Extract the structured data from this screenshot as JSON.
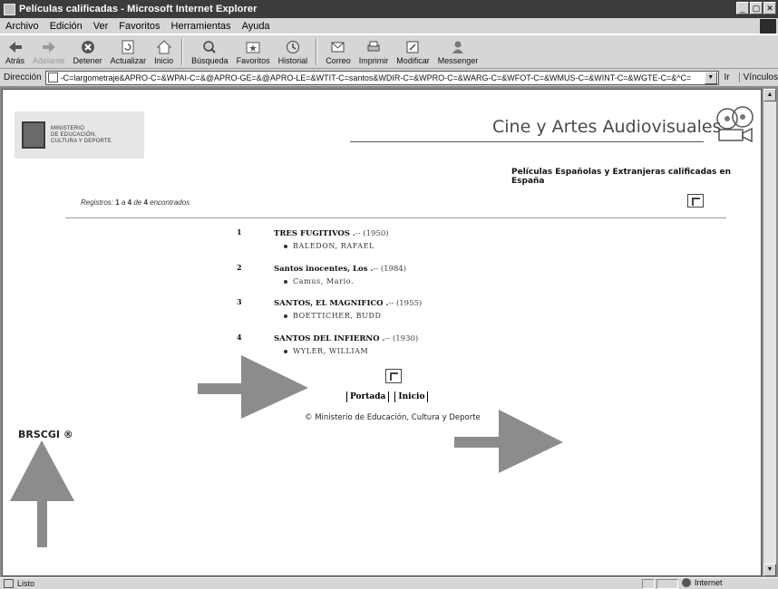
{
  "window": {
    "title": "Películas calificadas - Microsoft Internet Explorer",
    "buttons": [
      "_",
      "▢",
      "✕"
    ]
  },
  "menu": [
    "Archivo",
    "Edición",
    "Ver",
    "Favoritos",
    "Herramientas",
    "Ayuda"
  ],
  "toolbar": {
    "back": "Atrás",
    "forward": "Adelante",
    "stop": "Detener",
    "refresh": "Actualizar",
    "home": "Inicio",
    "search": "Búsqueda",
    "favorites": "Favoritos",
    "history": "Historial",
    "mail": "Correo",
    "print": "Imprimir",
    "edit": "Modificar",
    "messenger": "Messenger"
  },
  "address": {
    "label": "Dirección",
    "url": "-C=largometraje&APRO-C=&WPAI-C=&@APRO-GE=&@APRO-LE=&WTIT-C=santos&WDIR-C=&WPRO-C=&WARG-C=&WFOT-C=&WMUS-C=&WINT-C=&WGTE-C=&^C=",
    "go": "Ir",
    "links": "Vínculos"
  },
  "page": {
    "ministry_lines": [
      "MINISTERIO",
      "DE EDUCACIÓN,",
      "CULTURA Y DEPORTE"
    ],
    "site_title": "Cine y Artes Audiovisuales",
    "subtitle": "Películas Españolas y Extranjeras calificadas en España",
    "records": {
      "prefix": "Registros:",
      "from": "1",
      "sep1": "a",
      "to": "4",
      "sep2": "de",
      "total": "4",
      "suffix": "encontrados"
    },
    "films": [
      {
        "num": "1",
        "title": "TRES FUGITIVOS .",
        "year": "-- (1950)",
        "director": "BALEDON, RAFAEL"
      },
      {
        "num": "2",
        "title": "Santos inocentes, Los .",
        "year": "-- (1984)",
        "director": "Camus, Mario."
      },
      {
        "num": "3",
        "title": "SANTOS, EL MAGNIFICO .",
        "year": "-- (1955)",
        "director": "BOETTICHER, BUDD"
      },
      {
        "num": "4",
        "title": "SANTOS DEL INFIERNO .",
        "year": "-- (1930)",
        "director": "WYLER, WILLIAM"
      }
    ],
    "links": {
      "portada": "Portada",
      "inicio": "Inicio"
    },
    "copyright": "© Ministerio de Educación, Cultura y Deporte",
    "brscgi": "BRSCGI ®"
  },
  "status": {
    "text": "Listo",
    "zone": "Internet"
  }
}
